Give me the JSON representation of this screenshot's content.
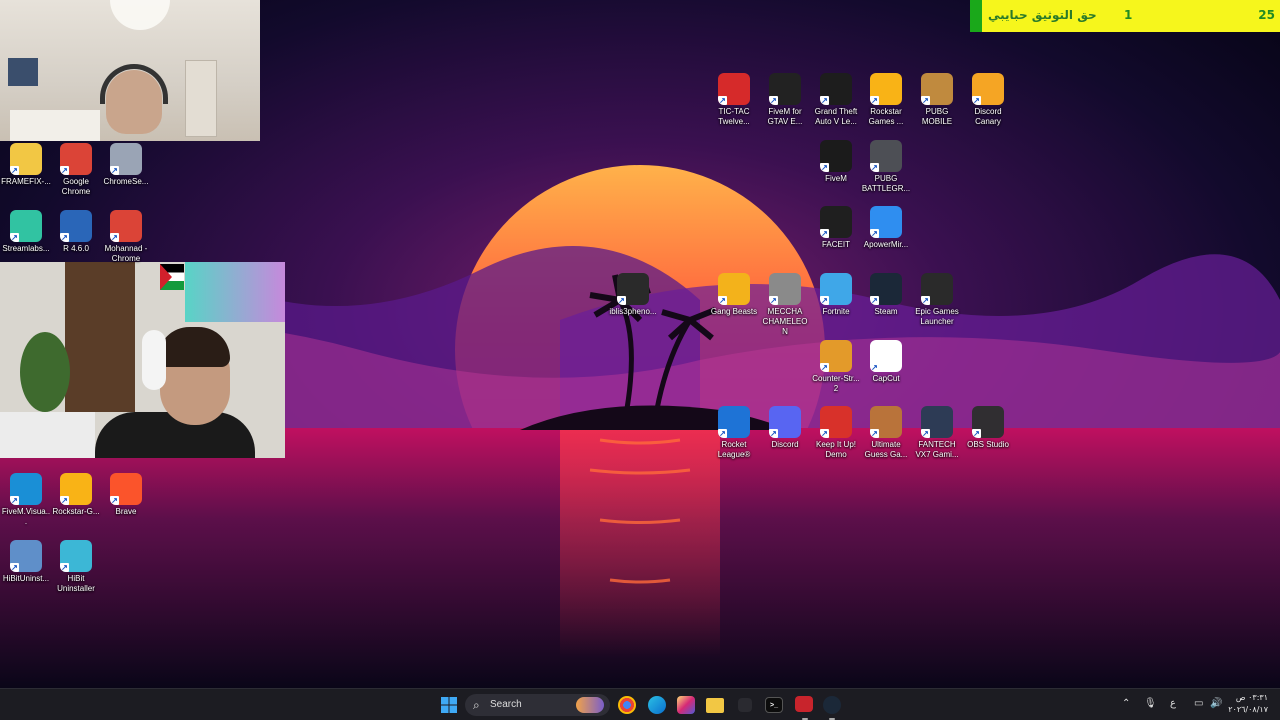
{
  "banner": {
    "count_left": "25",
    "count_mid": "1",
    "text": "حق التوثيق حبايبي"
  },
  "desktop_icons": [
    {
      "label": "FRAMEFIX-...",
      "icon": "folder-icon",
      "color": "#f2c744"
    },
    {
      "label": "Google Chrome",
      "icon": "chrome-icon",
      "color": "#db4437"
    },
    {
      "label": "ChromeSe...",
      "icon": "disc-icon",
      "color": "#9aa4b5"
    },
    {
      "label": "Streamlabs...",
      "icon": "streamlabs-icon",
      "color": "#31c3a2"
    },
    {
      "label": "R 4.6.0",
      "icon": "r-language-icon",
      "color": "#2a66b8"
    },
    {
      "label": "Mohannad - Chrome",
      "icon": "chrome-profile-icon",
      "color": "#db4437"
    },
    {
      "label": "FiveM.Visua...",
      "icon": "edge-icon",
      "color": "#1a8fd6"
    },
    {
      "label": "Rockstar-G...",
      "icon": "rockstar-icon",
      "color": "#f9b316"
    },
    {
      "label": "Brave",
      "icon": "brave-icon",
      "color": "#fb542b"
    },
    {
      "label": "HiBitUninst...",
      "icon": "installer-icon",
      "color": "#5f8fc9"
    },
    {
      "label": "HiBit Uninstaller",
      "icon": "hibit-icon",
      "color": "#3cb7d6"
    },
    {
      "label": "TIC-TAC Twelve...",
      "icon": "tictac-icon",
      "color": "#d62a2a"
    },
    {
      "label": "FiveM for GTAV E...",
      "icon": "fivem-icon",
      "color": "#222222"
    },
    {
      "label": "Grand Theft Auto V Le...",
      "icon": "gta-icon",
      "color": "#1d1d1d"
    },
    {
      "label": "Rockstar Games ...",
      "icon": "rockstar-icon",
      "color": "#f9b316"
    },
    {
      "label": "PUBG MOBILE",
      "icon": "pubg-mobile-icon",
      "color": "#c08a3e"
    },
    {
      "label": "Discord Canary",
      "icon": "discord-canary-icon",
      "color": "#f5a524"
    },
    {
      "label": "FiveM",
      "icon": "fivem-icon",
      "color": "#1b1b1b"
    },
    {
      "label": "PUBG BATTLEGR...",
      "icon": "pubg-helmet-icon",
      "color": "#4d4f55"
    },
    {
      "label": "FACEIT",
      "icon": "faceit-icon",
      "color": "#1f1f1f"
    },
    {
      "label": "ApowerMir...",
      "icon": "apowermirror-icon",
      "color": "#2f8ef0"
    },
    {
      "label": "iblis3pheno...",
      "icon": "iblis-icon",
      "color": "#2a2a2a"
    },
    {
      "label": "Gang Beasts",
      "icon": "gang-beasts-icon",
      "color": "#f3b21b"
    },
    {
      "label": "MECCHA CHAMELEON",
      "icon": "meccha-icon",
      "color": "#8a8a8a"
    },
    {
      "label": "Fortnite",
      "icon": "fortnite-icon",
      "color": "#3fa7e8"
    },
    {
      "label": "Steam",
      "icon": "steam-icon",
      "color": "#1b2838"
    },
    {
      "label": "Epic Games Launcher",
      "icon": "epic-games-icon",
      "color": "#2a2a2a"
    },
    {
      "label": "Counter-Str... 2",
      "icon": "counter-strike-icon",
      "color": "#e39a2a"
    },
    {
      "label": "CapCut",
      "icon": "capcut-icon",
      "color": "#ffffff"
    },
    {
      "label": "Rocket League®",
      "icon": "rocket-league-icon",
      "color": "#1e73d6"
    },
    {
      "label": "Discord",
      "icon": "discord-icon",
      "color": "#5865f2"
    },
    {
      "label": "Keep It Up! Demo",
      "icon": "keep-it-up-icon",
      "color": "#d8312a"
    },
    {
      "label": "Ultimate Guess Ga...",
      "icon": "ultimate-guess-icon",
      "color": "#b9733a"
    },
    {
      "label": "FANTECH VX7 Gami...",
      "icon": "mouse-icon",
      "color": "#2d3b55"
    },
    {
      "label": "OBS Studio",
      "icon": "obs-icon",
      "color": "#302e31"
    }
  ],
  "taskbar": {
    "search_label": "Search",
    "lang_indicator": "ع",
    "time": "٠٣:٣١ ص",
    "date": "٢٠٢٦/٠٨/١٧"
  }
}
